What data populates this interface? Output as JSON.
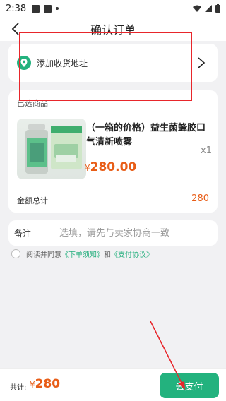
{
  "status_bar": {
    "time": "2:38"
  },
  "header": {
    "title": "确认订单"
  },
  "address": {
    "label": "添加收货地址"
  },
  "product_section": {
    "label": "已选商品",
    "product_name": "（一箱的价格）益生菌蜂胶口气清新喷雾",
    "quantity": "x1",
    "price_symbol": "¥",
    "price": "280.00",
    "total_label": "金额总计",
    "total_value": "280"
  },
  "note": {
    "label": "备注",
    "placeholder": "选填，请先与卖家协商一致"
  },
  "agreement": {
    "prefix": "阅读并同意",
    "link1": "《下单须知》",
    "and": "和",
    "link2": "《支付协议》"
  },
  "footer": {
    "total_label": "共计:",
    "price_symbol": "¥",
    "total_amount": "280",
    "pay_label": "去支付"
  },
  "colors": {
    "accent": "#23b27e",
    "price": "#e85d17",
    "highlight": "#e8262b"
  }
}
